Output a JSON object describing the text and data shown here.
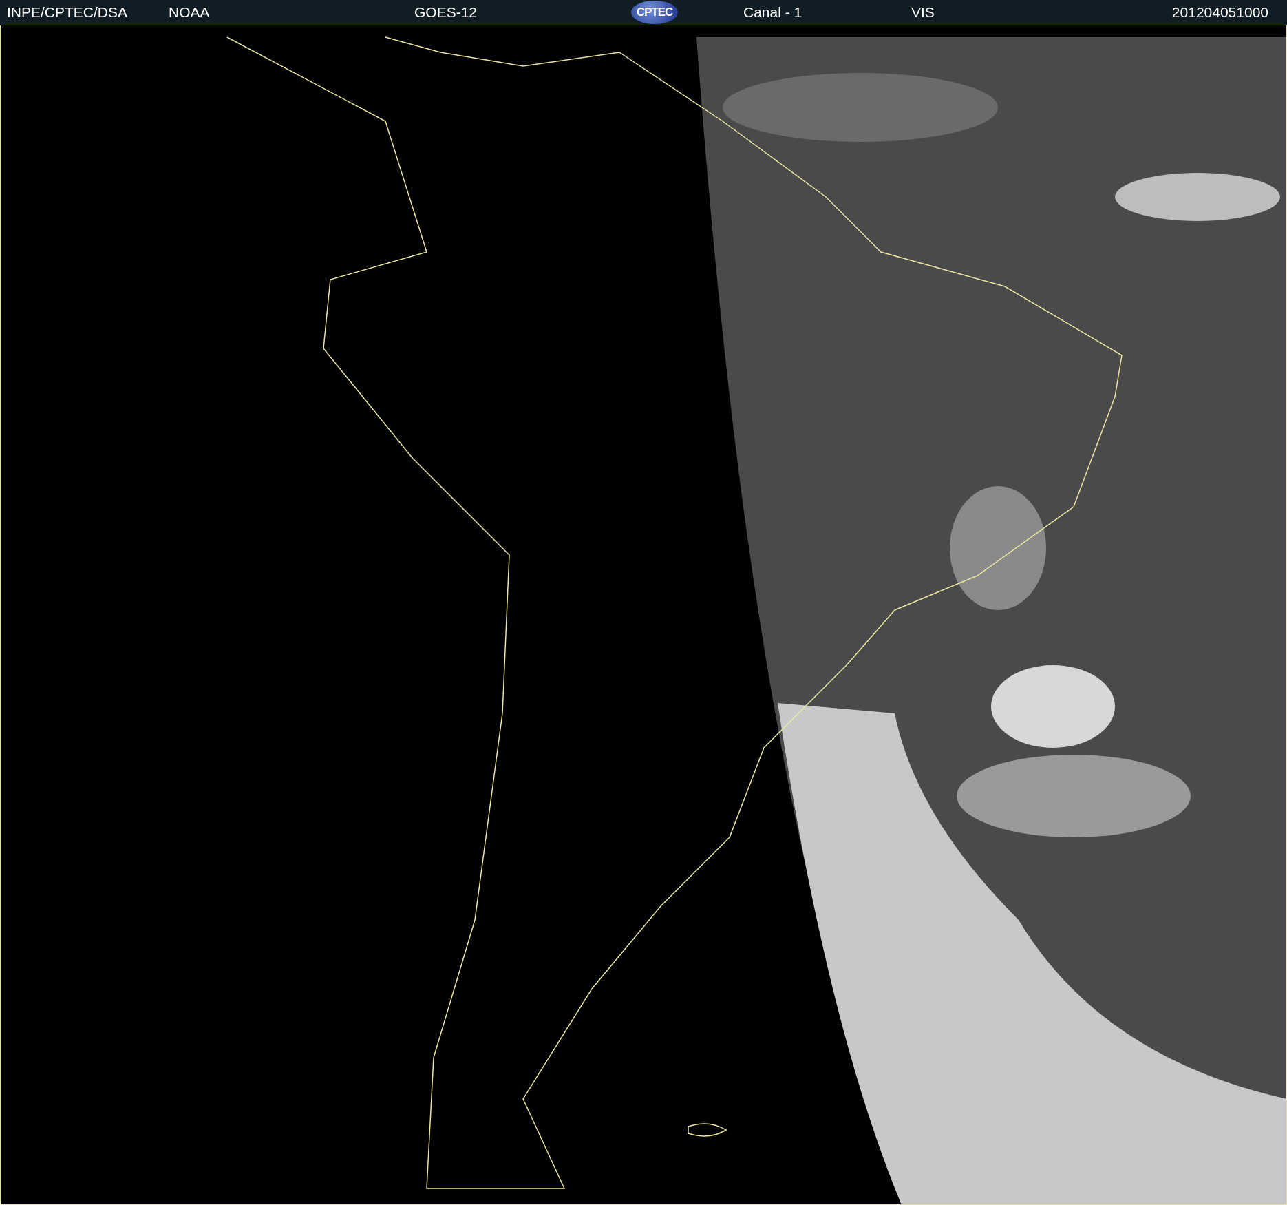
{
  "header": {
    "source": "INPE/CPTEC/DSA",
    "agency": "NOAA",
    "satellite": "GOES-12",
    "logo": "CPTEC",
    "channel": "Canal - 1",
    "band": "VIS",
    "timestamp": "201204051000"
  }
}
